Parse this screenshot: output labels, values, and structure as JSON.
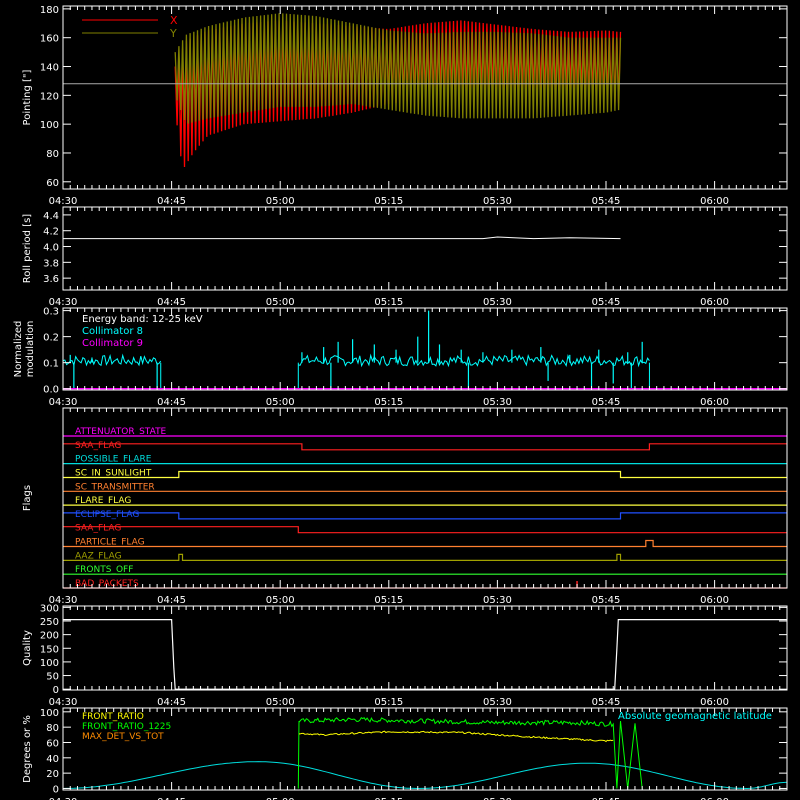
{
  "time_ticks": [
    "04:30",
    "04:45",
    "05:00",
    "05:15",
    "05:30",
    "05:45",
    "06:00"
  ],
  "chart_data": [
    {
      "type": "line",
      "ylabel": "Pointing [\"]",
      "ylim": [
        55,
        182
      ],
      "yticks": [
        "60",
        "80",
        "100",
        "120",
        "140",
        "160",
        "180"
      ],
      "xlim_minutes": [
        0,
        100
      ],
      "reference_line": 128,
      "legend": [
        {
          "name": "X",
          "color": "#ff0000"
        },
        {
          "name": "Y",
          "color": "#808000"
        }
      ],
      "series": [
        {
          "name": "X",
          "color": "#ff0000",
          "x_start_min": 15.5,
          "x_end_min": 77.0,
          "upper": [
            [
              15.5,
              140
            ],
            [
              17,
              158
            ],
            [
              20,
              165
            ],
            [
              25,
              170
            ],
            [
              30,
              172
            ],
            [
              35,
              170
            ],
            [
              40,
              168
            ],
            [
              45,
              166
            ],
            [
              50,
              170
            ],
            [
              55,
              172
            ],
            [
              60,
              169
            ],
            [
              65,
              166
            ],
            [
              70,
              164
            ],
            [
              75,
              165
            ],
            [
              77,
              164
            ]
          ],
          "lower": [
            [
              15.5,
              110
            ],
            [
              16.5,
              68
            ],
            [
              18,
              80
            ],
            [
              20,
              92
            ],
            [
              25,
              100
            ],
            [
              30,
              102
            ],
            [
              35,
              104
            ],
            [
              40,
              108
            ],
            [
              45,
              114
            ],
            [
              50,
              118
            ],
            [
              55,
              120
            ],
            [
              60,
              122
            ],
            [
              65,
              123
            ],
            [
              70,
              124
            ],
            [
              75,
              118
            ],
            [
              77,
              114
            ]
          ]
        },
        {
          "name": "Y",
          "color": "#808000",
          "x_start_min": 15.5,
          "x_end_min": 77.0,
          "upper": [
            [
              15.5,
              150
            ],
            [
              17,
              162
            ],
            [
              20,
              168
            ],
            [
              25,
              174
            ],
            [
              30,
              177
            ],
            [
              35,
              175
            ],
            [
              40,
              170
            ],
            [
              45,
              165
            ],
            [
              50,
              163
            ],
            [
              55,
              164
            ],
            [
              60,
              164
            ],
            [
              65,
              163
            ],
            [
              70,
              160
            ],
            [
              75,
              160
            ],
            [
              77,
              160
            ]
          ],
          "lower": [
            [
              15.5,
              120
            ],
            [
              17,
              100
            ],
            [
              20,
              104
            ],
            [
              25,
              108
            ],
            [
              30,
              112
            ],
            [
              35,
              112
            ],
            [
              40,
              114
            ],
            [
              45,
              110
            ],
            [
              50,
              106
            ],
            [
              55,
              104
            ],
            [
              60,
              104
            ],
            [
              65,
              104
            ],
            [
              70,
              106
            ],
            [
              75,
              108
            ],
            [
              77,
              110
            ]
          ]
        }
      ]
    },
    {
      "type": "line",
      "ylabel": "Roll period [s]",
      "ylim": [
        3.45,
        4.5
      ],
      "yticks": [
        "3.6",
        "3.8",
        "4.0",
        "4.2",
        "4.4"
      ],
      "xlim_minutes": [
        0,
        100
      ],
      "series": [
        {
          "color": "#ffffff",
          "x": [
            0,
            20,
            40,
            58,
            60,
            65,
            70,
            77
          ],
          "y": [
            4.1,
            4.1,
            4.1,
            4.1,
            4.12,
            4.1,
            4.11,
            4.1
          ]
        }
      ]
    },
    {
      "type": "line",
      "ylabel": "Normalized\nmodulation",
      "ylim": [
        -0.005,
        0.31
      ],
      "yticks": [
        "0.0",
        "0.1",
        "0.2",
        "0.3"
      ],
      "xlim_minutes": [
        0,
        100
      ],
      "legend": [
        {
          "name": "Energy band: 12-25 keV",
          "color": "#ffffff"
        },
        {
          "name": "Collimator 8",
          "color": "#00ffff"
        },
        {
          "name": "Collimator 9",
          "color": "#ff00ff"
        }
      ],
      "series": [
        {
          "name": "Collimator 8",
          "color": "#00ffff",
          "segments": [
            [
              0,
              13.5
            ],
            [
              32.5,
              81.0
            ]
          ],
          "baseline": 0.1,
          "spikes": [
            [
              1,
              0.13
            ],
            [
              4,
              0.12
            ],
            [
              33,
              0.14
            ],
            [
              36,
              0.16
            ],
            [
              38,
              0.18
            ],
            [
              40,
              0.19
            ],
            [
              43,
              0.17
            ],
            [
              46,
              0.15
            ],
            [
              49,
              0.2
            ],
            [
              50.5,
              0.3
            ],
            [
              52,
              0.17
            ],
            [
              55,
              0.15
            ],
            [
              58,
              0.14
            ],
            [
              62,
              0.15
            ],
            [
              66,
              0.16
            ],
            [
              70,
              0.13
            ],
            [
              74,
              0.15
            ],
            [
              78,
              0.14
            ],
            [
              80,
              0.18
            ]
          ],
          "dips": [
            [
              1.5,
              0.0
            ],
            [
              13,
              0.0
            ],
            [
              37,
              0.0
            ],
            [
              56,
              0.0
            ],
            [
              67,
              0.03
            ],
            [
              73,
              0.0
            ],
            [
              76,
              0.02
            ],
            [
              78.5,
              0.0
            ]
          ]
        },
        {
          "name": "Collimator 9",
          "color": "#ff00ff",
          "x": [
            0,
            100
          ],
          "y": [
            0.0,
            0.0
          ]
        }
      ]
    },
    {
      "type": "line",
      "ylabel": "Flags",
      "xlim_minutes": [
        0,
        100
      ],
      "flags": [
        {
          "label": "ATTENUATOR_STATE",
          "color": "#ff00ff",
          "steps": [
            [
              0,
              0
            ],
            [
              100,
              0
            ]
          ]
        },
        {
          "label": "SAA_FLAG",
          "color": "#ff2020",
          "steps": [
            [
              0,
              1
            ],
            [
              33,
              0
            ],
            [
              81,
              1
            ],
            [
              100,
              1
            ]
          ]
        },
        {
          "label": "POSSIBLE_FLARE",
          "color": "#00dddd",
          "steps": [
            [
              0,
              0
            ],
            [
              100,
              0
            ]
          ]
        },
        {
          "label": "SC_IN_SUNLIGHT",
          "color": "#ffff40",
          "steps": [
            [
              0,
              0
            ],
            [
              16,
              1
            ],
            [
              77,
              0
            ],
            [
              100,
              0
            ]
          ]
        },
        {
          "label": "SC_TRANSMITTER",
          "color": "#ff8030",
          "steps": [
            [
              0,
              0
            ],
            [
              100,
              0
            ]
          ]
        },
        {
          "label": "FLARE_FLAG",
          "color": "#ffff40",
          "steps": [
            [
              0,
              0
            ],
            [
              100,
              0
            ]
          ]
        },
        {
          "label": "ECLIPSE_FLAG",
          "color": "#2050ff",
          "steps": [
            [
              0,
              1
            ],
            [
              16,
              0
            ],
            [
              77,
              1
            ],
            [
              100,
              1
            ]
          ]
        },
        {
          "label": "SAA_FLAG",
          "color": "#ff2020",
          "steps": [
            [
              0,
              1
            ],
            [
              32.5,
              0
            ],
            [
              100,
              0
            ]
          ]
        },
        {
          "label": "PARTICLE_FLAG",
          "color": "#ff8030",
          "steps": [
            [
              0,
              0
            ],
            [
              80.5,
              0
            ],
            [
              80.5,
              1
            ],
            [
              81.5,
              1
            ],
            [
              81.5,
              0
            ],
            [
              100,
              0
            ]
          ]
        },
        {
          "label": "AAZ_FLAG",
          "color": "#a0a000",
          "steps": [
            [
              0,
              0
            ],
            [
              16,
              0
            ],
            [
              16,
              1
            ],
            [
              16.5,
              1
            ],
            [
              16.5,
              0
            ],
            [
              76.5,
              0
            ],
            [
              76.5,
              1
            ],
            [
              77,
              1
            ],
            [
              77,
              0
            ],
            [
              100,
              0
            ]
          ]
        },
        {
          "label": "FRONTS_OFF",
          "color": "#30ff30",
          "steps": [
            [
              0,
              0
            ],
            [
              100,
              0
            ]
          ]
        },
        {
          "label": "BAD_PACKETS",
          "color": "#ff2020",
          "steps": [
            [
              0,
              0
            ],
            [
              100,
              0
            ]
          ],
          "spike_at": 71
        }
      ]
    },
    {
      "type": "line",
      "ylabel": "Quality",
      "ylim": [
        -3,
        305
      ],
      "yticks": [
        "0",
        "50",
        "100",
        "150",
        "200",
        "250",
        "300"
      ],
      "xlim_minutes": [
        0,
        100
      ],
      "series": [
        {
          "color": "#ffffff",
          "x": [
            0,
            15.0,
            15.3,
            15.5,
            76.2,
            76.5,
            76.7,
            100
          ],
          "y": [
            255,
            255,
            80,
            0,
            0,
            150,
            255,
            255
          ]
        }
      ]
    },
    {
      "type": "line",
      "ylabel": "Degrees or %",
      "ylim": [
        -2,
        105
      ],
      "yticks": [
        "0",
        "20",
        "40",
        "60",
        "80",
        "100"
      ],
      "xlim_minutes": [
        0,
        100
      ],
      "legend": [
        {
          "name": "FRONT_RATIO",
          "color": "#ffff00"
        },
        {
          "name": "FRONT_RATIO_1225",
          "color": "#00ff00"
        },
        {
          "name": "MAX_DET_VS_TOT",
          "color": "#ff8c00"
        }
      ],
      "annotation": {
        "text": "Absolute geomagnetic latitude",
        "color": "#00ffff"
      },
      "series": [
        {
          "name": "Absolute geomagnetic latitude",
          "color": "#00dddd",
          "x": [
            0,
            27,
            49,
            72.5,
            94.5,
            100
          ],
          "y": [
            0,
            35,
            0,
            33,
            0,
            8
          ]
        },
        {
          "name": "FRONT_RATIO_1225",
          "color": "#00ff00",
          "x": [
            32.5,
            32.6,
            40,
            50,
            60,
            70,
            76,
            76.5,
            77,
            78,
            79,
            80
          ],
          "y": [
            0,
            88,
            90,
            88,
            86,
            86,
            84,
            0,
            88,
            0,
            85,
            0
          ],
          "noise": 6
        },
        {
          "name": "FRONT_RATIO",
          "color": "#ffff00",
          "x": [
            32.6,
            36,
            45,
            55,
            65,
            75,
            76.2
          ],
          "y": [
            72,
            70,
            74,
            73,
            67,
            62,
            63
          ],
          "noise": 2
        }
      ]
    }
  ]
}
